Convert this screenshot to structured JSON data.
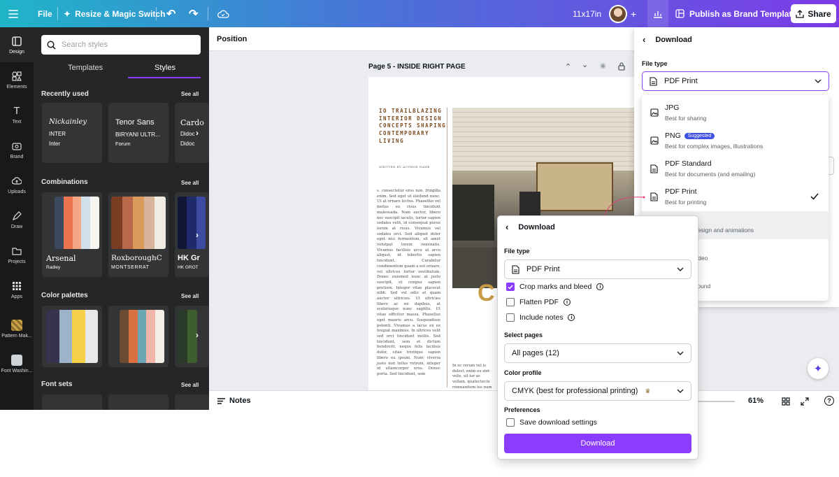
{
  "topbar": {
    "file": "File",
    "resize": "Resize & Magic Switch",
    "size": "11x17in",
    "publish": "Publish as Brand Template",
    "share": "Share"
  },
  "rail": [
    {
      "label": "Design",
      "icon": "design-icon"
    },
    {
      "label": "Elements",
      "icon": "elements-icon"
    },
    {
      "label": "Text",
      "icon": "text-icon"
    },
    {
      "label": "Brand",
      "icon": "brand-icon"
    },
    {
      "label": "Uploads",
      "icon": "uploads-icon"
    },
    {
      "label": "Draw",
      "icon": "draw-icon"
    },
    {
      "label": "Projects",
      "icon": "projects-icon"
    },
    {
      "label": "Apps",
      "icon": "apps-icon"
    },
    {
      "label": "Pattern Mak...",
      "icon": "pattern-maker-icon"
    },
    {
      "label": "Font Washin...",
      "icon": "font-washing-icon"
    }
  ],
  "panel": {
    "search_placeholder": "Search styles",
    "tabs": [
      "Templates",
      "Styles"
    ],
    "recently_used": "Recently used",
    "combinations": "Combinations",
    "color_palettes": "Color palettes",
    "font_sets": "Font sets",
    "see_all": "See all",
    "font_cards": [
      {
        "l1": "Nickainley",
        "l2": "INTER",
        "l3": "Inter"
      },
      {
        "l1": "Tenor Sans",
        "l2": "BIRYANI ULTR...",
        "l3": "Forum"
      },
      {
        "l1": "Cardo",
        "l2": "Didoc",
        "l3": "Didoc"
      }
    ],
    "combos": [
      {
        "title": "Arsenal",
        "sub": "Radley",
        "colors": [
          "#3b4a5e",
          "#e9744e",
          "#f4a784",
          "#cfe0ea",
          "#f7f7f2"
        ]
      },
      {
        "title": "RoxboroughC",
        "sub": "MONTSERRAT",
        "colors": [
          "#7a3e25",
          "#b9684a",
          "#d99a5a",
          "#d8b49b",
          "#f1ece1"
        ]
      },
      {
        "title": "HK Gr",
        "sub": "HK GROT",
        "colors": [
          "#0f1636",
          "#1f2a6b",
          "#3c4ba0"
        ]
      }
    ],
    "palettes": [
      [
        "#36334f",
        "#9cb3ca",
        "#f7d04a",
        "#e8e8e8"
      ],
      [
        "#6b4c33",
        "#d97041",
        "#6aa6b3",
        "#f1b5a9",
        "#f4efe6"
      ],
      [
        "#2a3b2a",
        "#3f5e2f"
      ]
    ]
  },
  "canvas": {
    "position": "Position",
    "page_label": "Page 5 - INSIDE RIGHT PAGE",
    "headline": "IO TRAILBLAZING INTERIOR DESIGN CONCEPTS SHAPING CONTEMPORARY LIVING",
    "byline": "WRITTEN BY AUTHOR NAME",
    "body": "s. consectetur eros non. fringilla enim. Sed eget ut eleifend nunc. Ut at ornare lectus. Phasellus vel metus eu risus tincidunt malesuada. Nam auctor, libero nec suscipit iaculis, tortor sapien sodales velit, id consequat purus lorem at risus. Vivamus vel sodales orci. Sed aliquet dolor eget nisi fermentum, sit amet volutpat lorem venenatis. Vivamus facilisis arcu at arcu aliquet, id lobortis sapien tincidunt. Curabitur condimentum quam a est ornare, vel ultrices tortor vestibulum. Donec euismod nunc at justo suscipit, et congue sapien pretium. Integer vitae placerat nibh. Sed vel odio at quam auctor ultricies. Ut ultricies libero ac mi dapibus, at scelerisque nunc sagittis. Ut vitae efficitur massa. Phasellus eget mauris arcu. Suspendisse potenti. Vivamus a lacus ex ex feugiat maximus. In ultrices velit sed orci tincidunt mollis. Sed tincidunt, sem et dictum hendrerit, neque felis facilisis dolor, vitae tristique sapien libero eu ipsum. Nunc viverra justo non tellus rutrum, integer id ullamcorper eros. Donec porta. Sed tincidunt, sem",
    "body2": "In ec rerum vel is delest, enim ex sint velis, sit iur as vellam, quatectecte remnanitem ius num",
    "big_letter": "C",
    "notes": "Notes",
    "zoom": "61%"
  },
  "download_right": {
    "title": "Download",
    "file_type_label": "File type",
    "selected": "PDF Print",
    "options": [
      {
        "title": "JPG",
        "sub": "Best for sharing",
        "badge": ""
      },
      {
        "title": "PNG",
        "sub": "Best for complex images, illustrations",
        "badge": "Suggested"
      },
      {
        "title": "PDF Standard",
        "sub": "Best for documents (and emailing)",
        "badge": ""
      },
      {
        "title": "PDF Print",
        "sub": "Best for printing",
        "badge": ""
      }
    ],
    "hidden_sub_1": "o design and animations",
    "hidden_sub_2": "video",
    "hidden_sub_3": "o sound"
  },
  "download_center": {
    "title": "Download",
    "file_type_label": "File type",
    "selected": "PDF Print",
    "crop": "Crop marks and bleed",
    "flatten": "Flatten PDF",
    "include_notes": "Include notes",
    "select_pages_label": "Select pages",
    "pages_value": "All pages (12)",
    "color_profile_label": "Color profile",
    "color_value": "CMYK (best for professional printing)",
    "preferences_label": "Preferences",
    "save_settings": "Save download settings",
    "download_btn": "Download"
  },
  "colors": {
    "accent": "#8b3dff",
    "panel": "#252627",
    "rail": "#18191b"
  }
}
